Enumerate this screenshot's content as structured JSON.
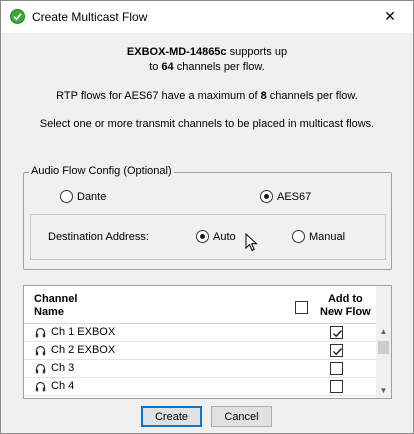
{
  "window": {
    "title": "Create Multicast Flow",
    "close_glyph": "✕"
  },
  "info": {
    "device": "EXBOX-MD-14865c",
    "supports_text": " supports up",
    "to_text": "to ",
    "channel_count": "64",
    "per_flow_text": " channels per flow.",
    "rtp_prefix": "RTP flows for AES67 have a maximum of ",
    "rtp_max": "8",
    "rtp_suffix": " channels per flow.",
    "instruction": "Select one or more transmit channels to be placed in multicast flows."
  },
  "audio_flow_config": {
    "legend": "Audio Flow Config (Optional)",
    "options": [
      {
        "label": "Dante",
        "selected": false
      },
      {
        "label": "AES67",
        "selected": true
      }
    ],
    "destination_label": "Destination Address:",
    "destination_options": [
      {
        "label": "Auto",
        "selected": true
      },
      {
        "label": "Manual",
        "selected": false
      }
    ]
  },
  "table": {
    "col_channel_line1": "Channel",
    "col_channel_line2": "Name",
    "col_add_line1": "Add to",
    "col_add_line2": "New Flow",
    "rows": [
      {
        "name": "Ch 1 EXBOX",
        "checked": true
      },
      {
        "name": "Ch 2 EXBOX",
        "checked": true
      },
      {
        "name": "Ch 3",
        "checked": false
      },
      {
        "name": "Ch 4",
        "checked": false
      }
    ],
    "scroll_up_glyph": "▲",
    "scroll_down_glyph": "▼"
  },
  "buttons": {
    "create": "Create",
    "cancel": "Cancel"
  },
  "icons": {
    "app": "green-check-icon",
    "channel": "headphones-icon",
    "cursor": "mouse-pointer-icon"
  },
  "colors": {
    "app_icon": "#3aa935",
    "default_button_border": "#0078d7"
  }
}
